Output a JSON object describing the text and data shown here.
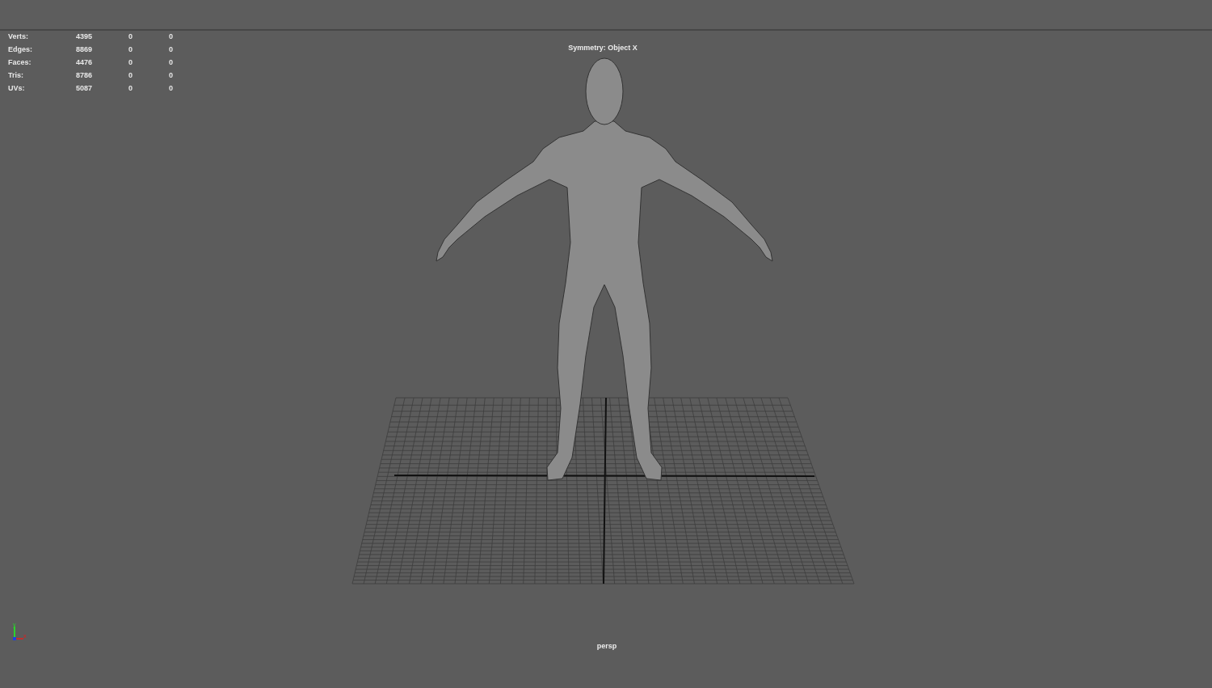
{
  "hud": {
    "stats": [
      {
        "label": "Verts:",
        "values": [
          "4395",
          "0",
          "0"
        ]
      },
      {
        "label": "Edges:",
        "values": [
          "8869",
          "0",
          "0"
        ]
      },
      {
        "label": "Faces:",
        "values": [
          "4476",
          "0",
          "0"
        ]
      },
      {
        "label": "Tris:",
        "values": [
          "8786",
          "0",
          "0"
        ]
      },
      {
        "label": "UVs:",
        "values": [
          "5087",
          "0",
          "0"
        ]
      }
    ],
    "symmetry": "Symmetry: Object X",
    "camera": "persp"
  },
  "axis_gizmo": {
    "labels": [
      "y",
      "x"
    ]
  }
}
